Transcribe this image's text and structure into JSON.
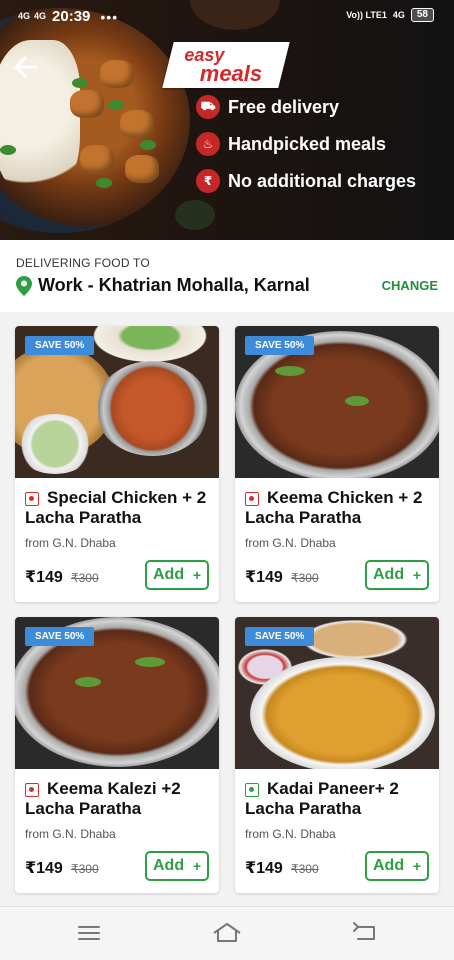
{
  "status_bar": {
    "signal1": "4G",
    "signal2": "4G",
    "time": "20:39",
    "dots": "•••",
    "volte": "Vo)) LTE1",
    "net": "4G",
    "battery": "58"
  },
  "banner": {
    "brand_line1": "easy",
    "brand_line2": "meals",
    "features": [
      {
        "icon": "truck-icon",
        "glyph": "⛟",
        "label": "Free delivery"
      },
      {
        "icon": "meal-icon",
        "glyph": "♨",
        "label": "Handpicked meals"
      },
      {
        "icon": "rupee-icon",
        "glyph": "₹",
        "label": "No additional charges"
      }
    ]
  },
  "address": {
    "label": "DELIVERING FOOD TO",
    "value": "Work - Khatrian Mohalla, Karnal",
    "change_label": "CHANGE"
  },
  "meals": [
    {
      "badge": "SAVE 50%",
      "type": "non-veg",
      "name": "Special Chicken + 2 Lacha Paratha",
      "from": "from G.N. Dhaba",
      "price": "₹149",
      "mrp": "₹300",
      "add_label": "Add",
      "add_plus": "+"
    },
    {
      "badge": "SAVE 50%",
      "type": "non-veg",
      "name": "Keema Chicken + 2 Lacha Paratha",
      "from": "from G.N. Dhaba",
      "price": "₹149",
      "mrp": "₹300",
      "add_label": "Add",
      "add_plus": "+"
    },
    {
      "badge": "SAVE 50%",
      "type": "non-veg",
      "name": "Keema Kalezi +2 Lacha Paratha",
      "from": "from G.N. Dhaba",
      "price": "₹149",
      "mrp": "₹300",
      "add_label": "Add",
      "add_plus": "+"
    },
    {
      "badge": "SAVE 50%",
      "type": "veg",
      "name": "Kadai Paneer+ 2 Lacha Paratha",
      "from": "from G.N. Dhaba",
      "price": "₹149",
      "mrp": "₹300",
      "add_label": "Add",
      "add_plus": "+"
    }
  ],
  "colors": {
    "accent_green": "#2e9e43",
    "brand_red": "#d62828",
    "badge_blue": "#3d8bd9"
  }
}
